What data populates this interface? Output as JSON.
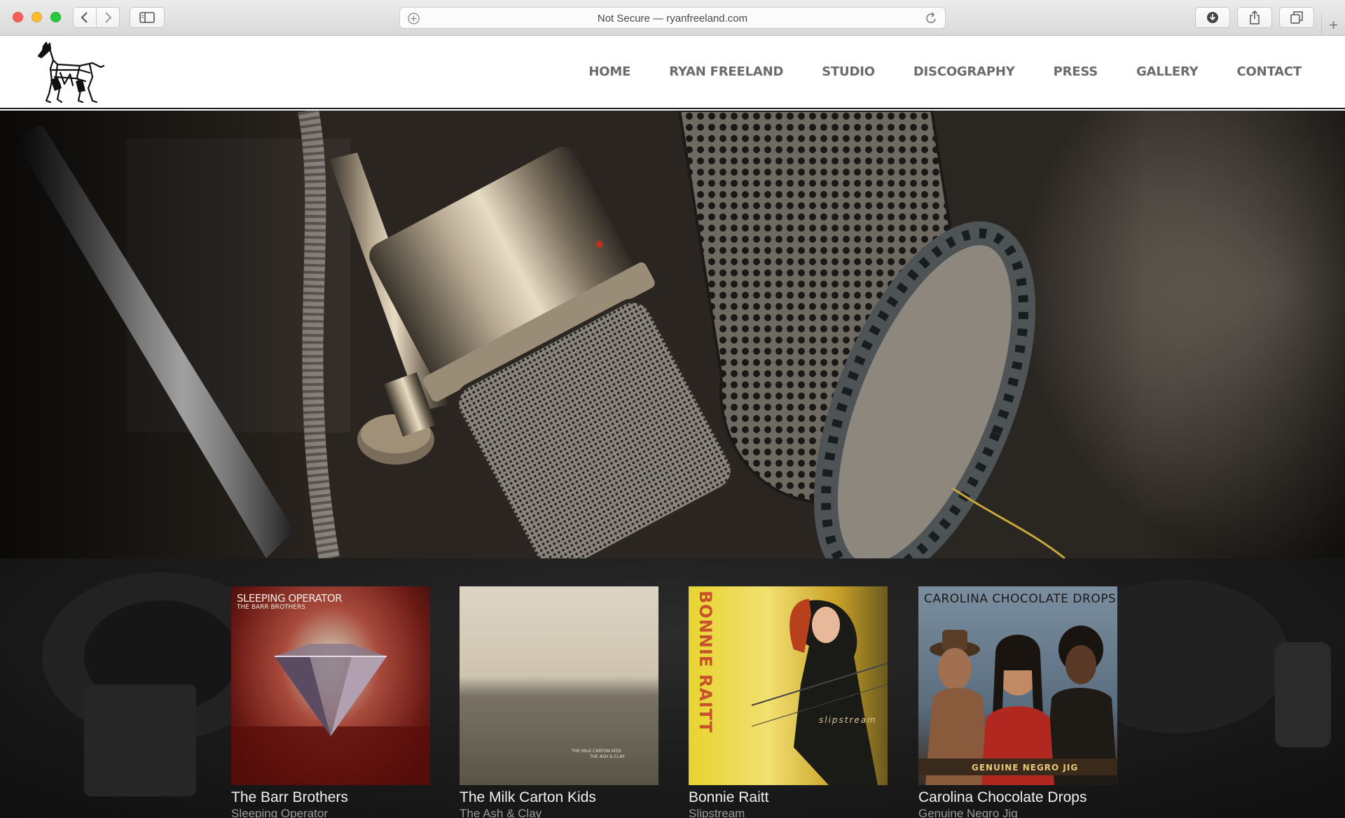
{
  "browser": {
    "address_text": "Not Secure — ryanfreeland.com"
  },
  "nav": {
    "items": [
      "HOME",
      "RYAN FREELAND",
      "STUDIO",
      "DISCOGRAPHY",
      "PRESS",
      "GALLERY",
      "CONTACT"
    ]
  },
  "albums": [
    {
      "artist": "The Barr Brothers",
      "title": "Sleeping Operator",
      "cover_line1": "SLEEPING OPERATOR",
      "cover_line2": "THE BARR BROTHERS"
    },
    {
      "artist": "The Milk Carton Kids",
      "title": "The Ash & Clay",
      "cover_line1": "THE MILK CARTON KIDS",
      "cover_line2": "THE ASH & CLAY"
    },
    {
      "artist": "Bonnie Raitt",
      "title": "Slipstream",
      "cover_line1": "BONNIE RAITT",
      "cover_line2": "slipstream"
    },
    {
      "artist": "Carolina Chocolate Drops",
      "title": "Genuine Negro Jig",
      "cover_line1": "CAROLINA CHOCOLATE DROPS",
      "cover_line2": "GENUINE NEGRO JIG"
    }
  ],
  "colors": {
    "nav_text": "#6b6b6b",
    "album_artist": "#f1f1f1",
    "album_title": "#9b9b9b"
  },
  "icons": [
    "back-chevron-icon",
    "forward-chevron-icon",
    "sidebar-icon",
    "add-circle-icon",
    "reload-icon",
    "download-icon",
    "share-icon",
    "tabs-icon",
    "plus-icon",
    "horse-logo"
  ]
}
